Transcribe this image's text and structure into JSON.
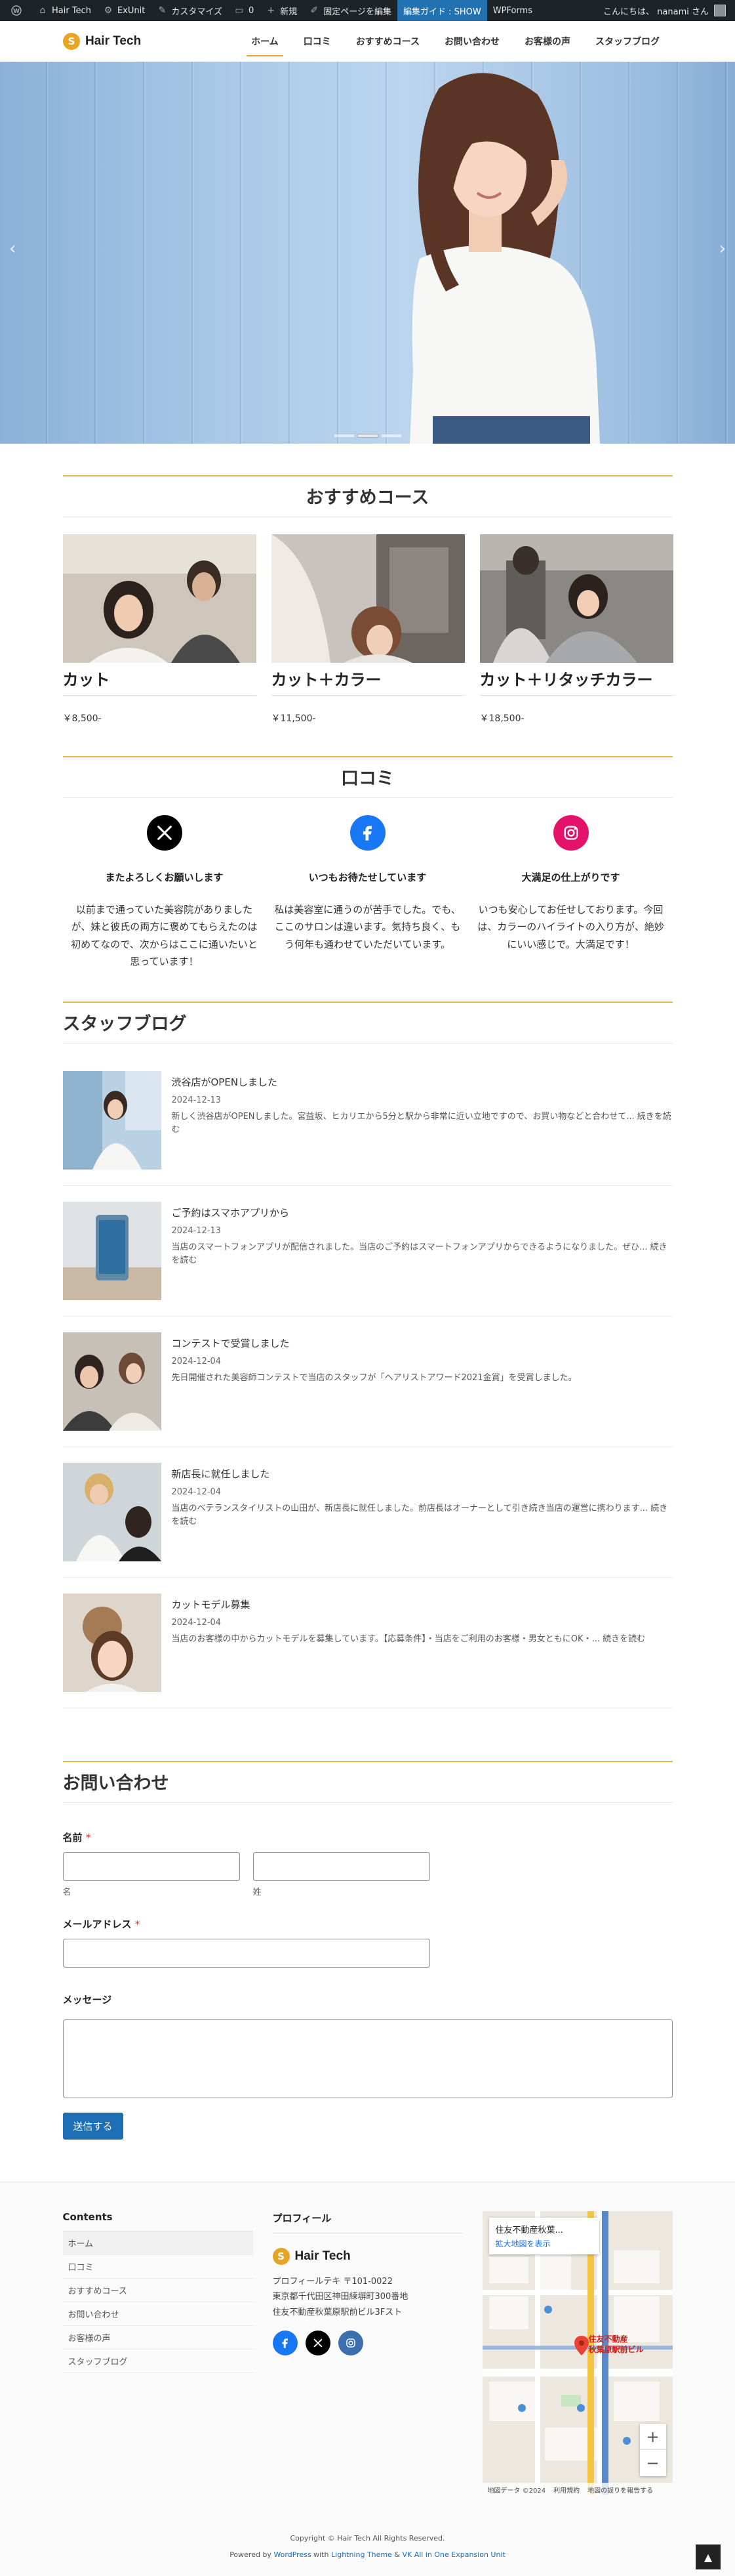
{
  "adminbar": {
    "items": [
      {
        "label": "",
        "icon": "wordpress-icon"
      },
      {
        "label": "Hair Tech",
        "icon": "home-icon"
      },
      {
        "label": "ExUnit",
        "icon": "gear-icon"
      },
      {
        "label": "カスタマイズ",
        "icon": "brush-icon"
      },
      {
        "label": "",
        "icon": "comment-icon"
      },
      {
        "label": "新規",
        "icon": "plus-icon"
      },
      {
        "label": "固定ページを編集",
        "icon": "edit-icon"
      },
      {
        "label": "編集ガイド : SHOW",
        "icon": ""
      },
      {
        "label": "WPForms",
        "icon": ""
      }
    ],
    "greeting": "こんにちは、 nanami さん"
  },
  "header": {
    "logo": "Hair Tech",
    "nav": [
      "ホーム",
      "口コミ",
      "おすすめコース",
      "お問い合わせ",
      "お客様の声",
      "スタッフブログ"
    ]
  },
  "hero": {
    "prev": "‹",
    "next": "›"
  },
  "courses": {
    "title": "おすすめコース",
    "items": [
      {
        "name": "カット",
        "price": "￥8,500-"
      },
      {
        "name": "カット＋カラー",
        "price": "￥11,500-"
      },
      {
        "name": "カット＋リタッチカラー",
        "price": "￥18,500-"
      }
    ]
  },
  "reviews": {
    "title": "口コミ",
    "items": [
      {
        "icon": "x-icon",
        "color": "#000000",
        "title": "またよろしくお願いします",
        "text": "以前まで通っていた美容院がありましたが、妹と彼氏の両方に褒めてもらえたのは初めてなので、次からはここに通いたいと思っています！"
      },
      {
        "icon": "facebook-icon",
        "color": "#1877f2",
        "title": "いつもお待たせしています",
        "text": "私は美容室に通うのが苦手でした。でも、ここのサロンは違います。気持ち良く、もう何年も通わせていただいています。"
      },
      {
        "icon": "instagram-icon",
        "color": "#e4126b",
        "title": "大満足の仕上がりです",
        "text": "いつも安心してお任せしております。今回は、カラーのハイライトの入り方が、絶妙にいい感じで。大満足です！"
      }
    ]
  },
  "blog": {
    "title": "スタッフブログ",
    "posts": [
      {
        "title": "渋谷店がOPENしました",
        "date": "2024-12-13",
        "excerpt": "新しく渋谷店がOPENしました。宮益坂、ヒカリエから5分と駅から非常に近い立地ですので、お買い物などと合わせて... 続きを読む"
      },
      {
        "title": "ご予約はスマホアプリから",
        "date": "2024-12-13",
        "excerpt": "当店のスマートフォンアプリが配信されました。当店のご予約はスマートフォンアプリからできるようになりました。ぜひ... 続きを読む"
      },
      {
        "title": "コンテストで受賞しました",
        "date": "2024-12-04",
        "excerpt": "先日開催された美容師コンテストで当店のスタッフが「ヘアリストアワード2021金賞」を受賞しました。"
      },
      {
        "title": "新店長に就任しました",
        "date": "2024-12-04",
        "excerpt": "当店のベテランスタイリストの山田が、新店長に就任しました。前店長はオーナーとして引き続き当店の運営に携わります... 続きを読む"
      },
      {
        "title": "カットモデル募集",
        "date": "2024-12-04",
        "excerpt": "当店のお客様の中からカットモデルを募集しています。【応募条件】・当店をご利用のお客様・男女ともにOK・... 続きを読む"
      }
    ]
  },
  "contact": {
    "title": "お問い合わせ",
    "name_label": "名前",
    "required_mark": "*",
    "first_sub": "名",
    "last_sub": "姓",
    "email_label": "メールアドレス",
    "message_label": "メッセージ",
    "submit": "送信する"
  },
  "footer": {
    "contents_title": "Contents",
    "menu": [
      "ホーム",
      "口コミ",
      "おすすめコース",
      "お問い合わせ",
      "お客様の声",
      "スタッフブログ"
    ],
    "profile_title": "プロフィール",
    "profile_logo": "Hair Tech",
    "profile_lines": [
      "プロフィールテキ 〒101-0022",
      "東京都千代田区神田練塀町300番地",
      "住友不動産秋葉原駅前ビル3Fスト"
    ],
    "map_place": "住友不動産秋葉...",
    "map_link": "拡大地図を表示",
    "map_pin_label": "住友不動産\n秋葉原駅前ビル",
    "map_zoom_in": "+",
    "map_zoom_out": "−",
    "map_credit": "地図データ ©2024",
    "map_terms": "利用規約",
    "map_report": "地図の誤りを報告する",
    "copyright": "Copyright © Hair Tech All Rights Reserved.",
    "powered_prefix": "Powered by ",
    "powered_wp": "WordPress",
    "powered_with": " with ",
    "powered_theme": "Lightning Theme",
    "powered_amp": " & ",
    "powered_plugin": "VK All in One Expansion Unit"
  }
}
